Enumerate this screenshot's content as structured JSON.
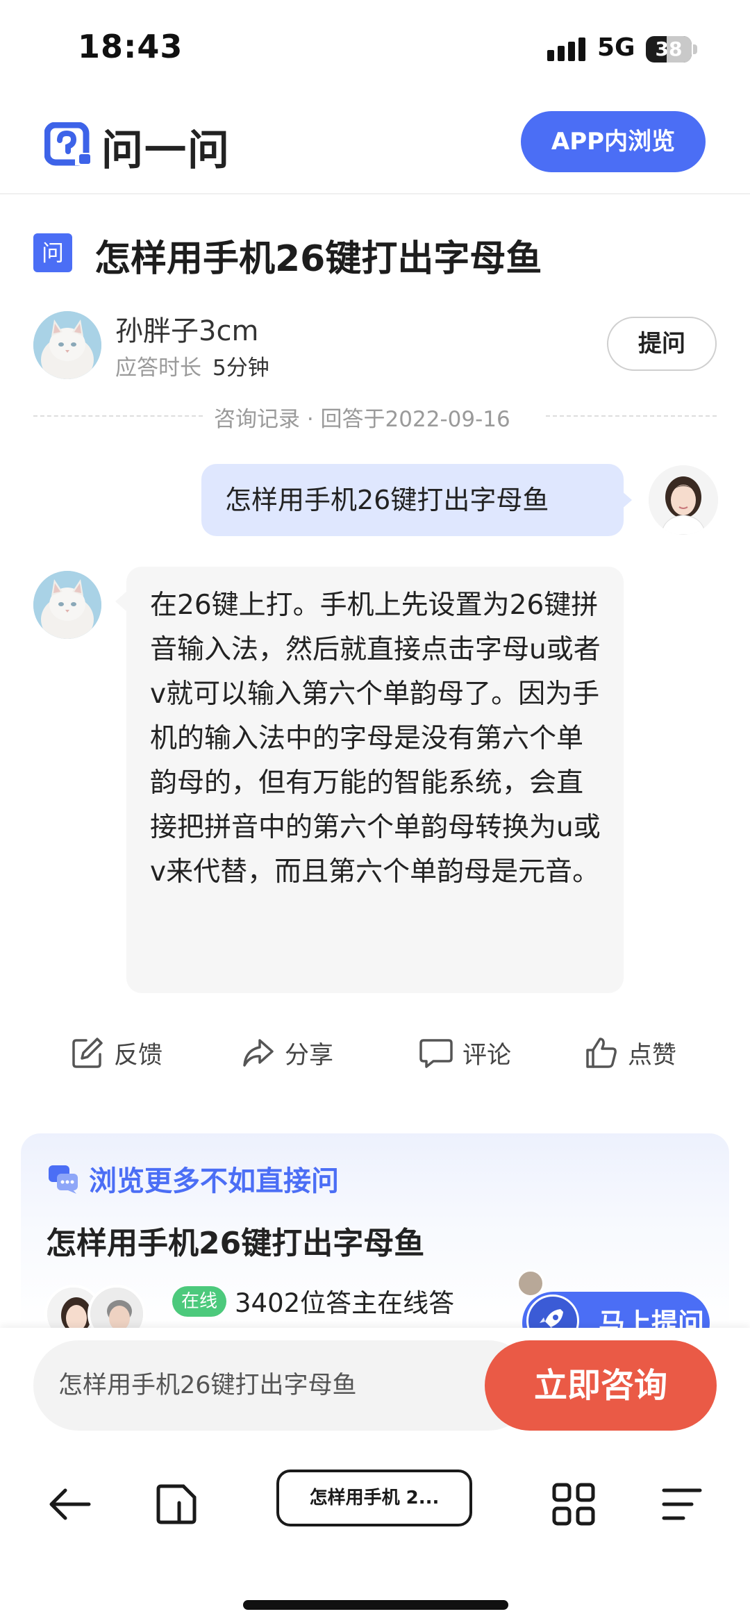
{
  "status_bar": {
    "time": "18:43",
    "network": "5G",
    "battery": "38",
    "battery_level_percent": 38
  },
  "header": {
    "logo_text": "问一问",
    "app_button": "APP内浏览"
  },
  "question": {
    "badge": "问",
    "title": "怎样用手机26键打出字母鱼"
  },
  "answerer": {
    "name": "孙胖子3cm",
    "duration_label": "应答时长",
    "duration_value": "5分钟",
    "ask_button": "提问"
  },
  "record": {
    "text": "咨询记录 · 回答于2022-09-16"
  },
  "chat": {
    "user_message": "怎样用手机26键打出字母鱼",
    "answer": "在26键上打。手机上先设置为26键拼音输入法，然后就直接点击字母u或者v就可以输入第六个单韵母了。因为手机的输入法中的字母是没有第六个单韵母的，但有万能的智能系统，会直接把拼音中的第六个单韵母转换为u或v来代替，而且第六个单韵母是元音。"
  },
  "actions": {
    "feedback": "反馈",
    "share": "分享",
    "comment": "评论",
    "like": "点赞"
  },
  "recommend": {
    "heading": "浏览更多不如直接问",
    "title": "怎样用手机26键打出字母鱼",
    "online_badge": "在线",
    "online_text": "3402位答主在线答",
    "ask_now": "马上提问"
  },
  "consult": {
    "input_value": "怎样用手机26键打出字母鱼",
    "button": "立即咨询"
  },
  "browser": {
    "tab_title": "怎样用手机 2..."
  },
  "colors": {
    "accent": "#4b6ef5",
    "consult": "#ea5a46",
    "online": "#4cc97c"
  }
}
